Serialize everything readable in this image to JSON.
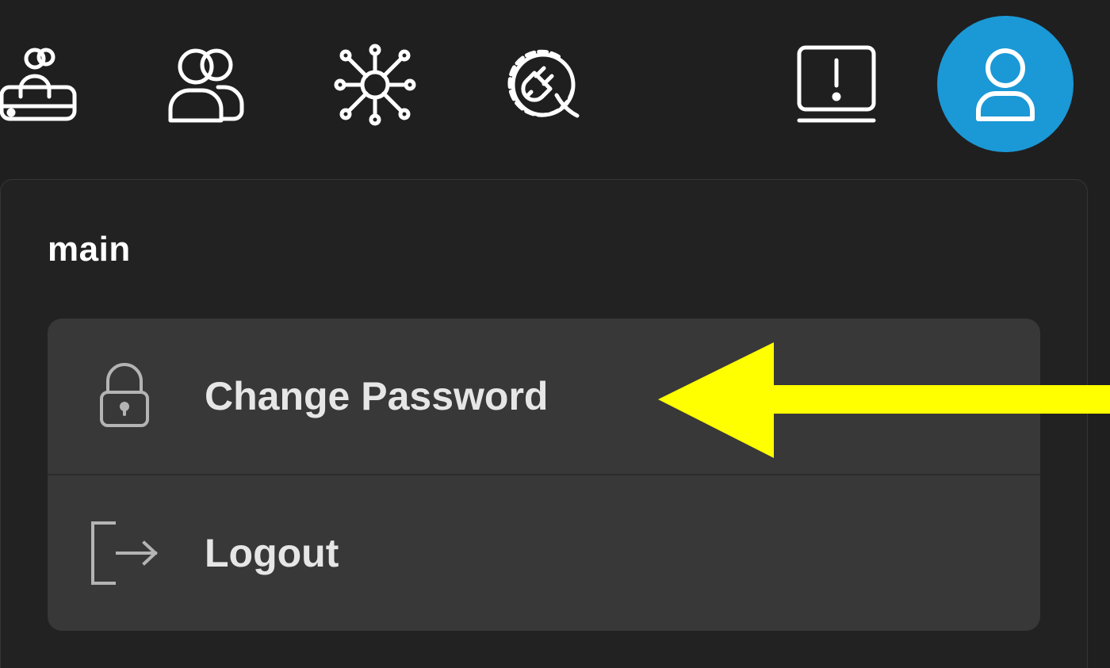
{
  "toolbar": {
    "icons": [
      "storage-users-icon",
      "users-icon",
      "network-icon",
      "plugin-icon",
      "alert-icon"
    ],
    "avatar_icon": "user-icon",
    "avatar_color": "#1b98d6"
  },
  "dropdown": {
    "account_name": "main",
    "items": [
      {
        "label": "Change Password",
        "icon": "lock-icon"
      },
      {
        "label": "Logout",
        "icon": "logout-icon"
      }
    ]
  },
  "annotation": {
    "arrow_color": "#ffff00"
  }
}
